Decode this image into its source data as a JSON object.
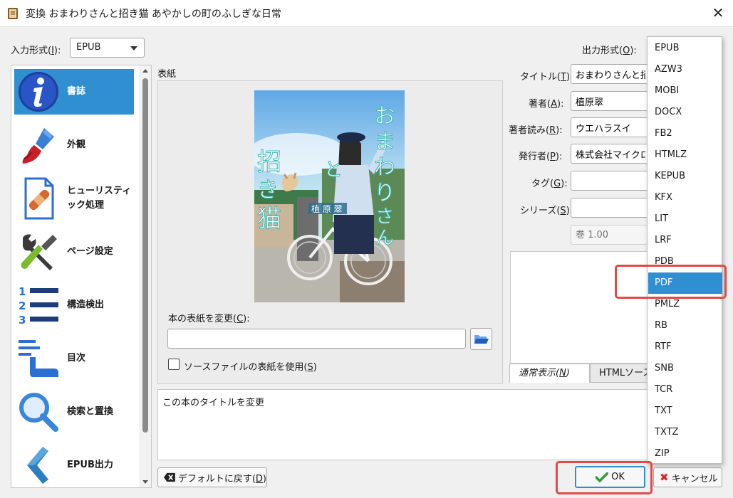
{
  "window": {
    "title": "変換 おまわりさんと招き猫 あやかしの町のふしぎな日常"
  },
  "input_format": {
    "label": "入力形式(I):",
    "value": "EPUB"
  },
  "output_format": {
    "label": "出力形式(O):"
  },
  "sidebar": {
    "items": [
      {
        "label": "書誌",
        "icon": "info-icon"
      },
      {
        "label": "外観",
        "icon": "paintbrush-icon"
      },
      {
        "label": "ヒューリスティック処理",
        "icon": "bandaid-document-icon"
      },
      {
        "label": "ページ設定",
        "icon": "wrench-screwdriver-icon"
      },
      {
        "label": "構造検出",
        "icon": "numbered-list-icon"
      },
      {
        "label": "目次",
        "icon": "toc-pointer-icon"
      },
      {
        "label": "検索と置換",
        "icon": "magnifier-icon"
      },
      {
        "label": "EPUB出力",
        "icon": "epub-chevron-icon"
      }
    ]
  },
  "cover": {
    "group_label": "表紙",
    "change_label": "本の表紙を変更(C):",
    "path_value": "",
    "use_source_label": "ソースファイルの表紙を使用(S)",
    "use_source_checked": false,
    "book_title_vertical": "おまわりさんと招き猫",
    "author_vertical": "植原 翠"
  },
  "metadata": {
    "title_label": "タイトル(T):",
    "title_value": "おまわりさんと招き",
    "author_label": "著者(A):",
    "author_value": "植原翠",
    "author_sort_label": "著者読み(R):",
    "author_sort_value": "ウエハラスイ",
    "publisher_label": "発行者(P):",
    "publisher_value": "株式会社マイクロ",
    "tags_label": "タグ(G):",
    "tags_value": "",
    "series_label": "シリーズ(S):",
    "series_value": "",
    "series_index_placeholder": "巻 1.00"
  },
  "comment_tabs": {
    "normal": "通常表示(N)",
    "html": "HTMLソース"
  },
  "description": "この本のタイトルを変更",
  "buttons": {
    "restore_defaults": "デフォルトに戻す(D)",
    "ok": "OK",
    "cancel": "キャンセル"
  },
  "output_dropdown": {
    "options": [
      "EPUB",
      "AZW3",
      "MOBI",
      "DOCX",
      "FB2",
      "HTMLZ",
      "KEPUB",
      "KFX",
      "LIT",
      "LRF",
      "PDB",
      "PDF",
      "PMLZ",
      "RB",
      "RTF",
      "SNB",
      "TCR",
      "TXT",
      "TXTZ",
      "ZIP"
    ],
    "selected": "PDF"
  },
  "colors": {
    "selection": "#2f8fd0",
    "highlight": "#e04a47",
    "ok_check": "#2e9e3a",
    "cancel_x": "#d42b2b"
  }
}
